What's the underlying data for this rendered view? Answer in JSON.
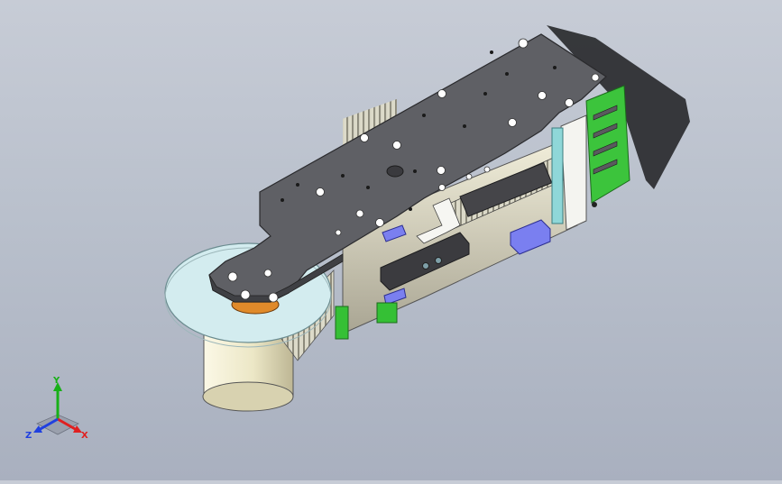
{
  "viewport": {
    "background_top": "#c7ccd6",
    "background_bottom": "#a9b0bf"
  },
  "model": {
    "plate_color": "#5f6065",
    "wheel_color": "#cfe8ec",
    "green_accent": "#3cc43c",
    "blue_accent": "#7a7ff0",
    "cylinder_color": "#ece7c6"
  },
  "triad": {
    "x_label": "X",
    "y_label": "Y",
    "z_label": "Z",
    "x_color": "#e02020",
    "y_color": "#18b018",
    "z_color": "#2040e0"
  }
}
